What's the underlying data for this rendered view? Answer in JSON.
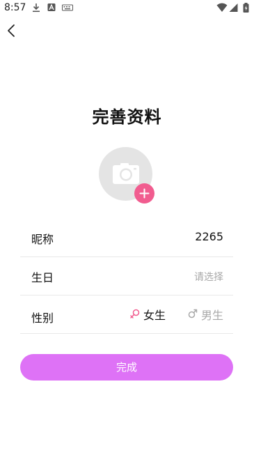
{
  "status_bar": {
    "time": "8:57",
    "icons": [
      "download-icon",
      "a-icon",
      "keyboard-icon",
      "wifi-icon",
      "cellular-icon",
      "battery-icon"
    ]
  },
  "header": {
    "back_icon": "back-arrow-icon"
  },
  "page": {
    "title": "完善资料"
  },
  "avatar": {
    "icon": "camera-icon",
    "add_icon": "plus-icon",
    "add_color": "#f15c8f"
  },
  "form": {
    "nickname": {
      "label": "昵称",
      "value": "2265"
    },
    "birthday": {
      "label": "生日",
      "placeholder": "请选择"
    },
    "gender": {
      "label": "性别",
      "options": [
        {
          "label": "女生",
          "icon": "female-icon",
          "selected": true
        },
        {
          "label": "男生",
          "icon": "male-icon",
          "selected": false
        }
      ]
    }
  },
  "submit": {
    "label": "完成",
    "color": "#de72f6"
  },
  "colors": {
    "accent": "#f15c8f",
    "button": "#de72f6",
    "muted": "#a8a8a8"
  }
}
